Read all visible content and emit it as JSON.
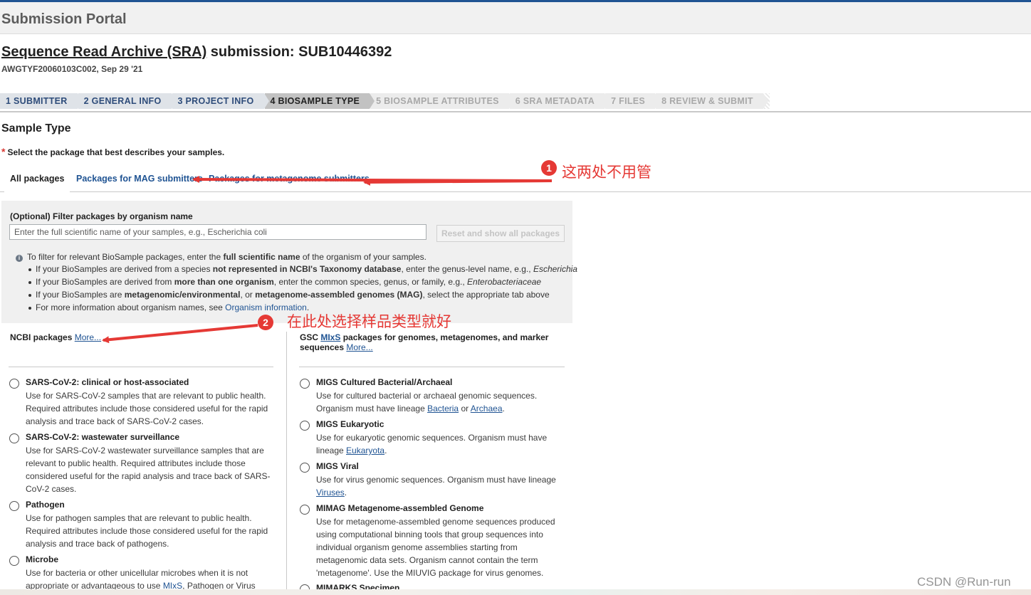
{
  "portal": {
    "title": "Submission Portal"
  },
  "submission": {
    "title_link": "Sequence Read Archive (SRA)",
    "title_rest": " submission: SUB10446392",
    "meta": "AWGTYF20060103C002, Sep 29 '21"
  },
  "steps": [
    {
      "label": "1 SUBMITTER",
      "state": "done"
    },
    {
      "label": "2 GENERAL INFO",
      "state": "done"
    },
    {
      "label": "3 PROJECT INFO",
      "state": "done"
    },
    {
      "label": "4 BIOSAMPLE TYPE",
      "state": "active"
    },
    {
      "label": "5 BIOSAMPLE ATTRIBUTES",
      "state": "disabled"
    },
    {
      "label": "6 SRA METADATA",
      "state": "disabled"
    },
    {
      "label": "7 FILES",
      "state": "disabled"
    },
    {
      "label": "8 REVIEW & SUBMIT",
      "state": "disabled"
    }
  ],
  "section": {
    "title": "Sample Type",
    "required_star": "*",
    "instruction": "Select the package that best describes your samples."
  },
  "tabs": {
    "all": "All packages",
    "mag": "Packages for MAG submitters",
    "metagenome": "Packages for metagenome submitters"
  },
  "filter": {
    "label": "(Optional) Filter packages by organism name",
    "placeholder": "Enter the full scientific name of your samples, e.g., Escherichia coli",
    "reset_button": "Reset and show all packages",
    "info_icon": "info-icon",
    "info_intro_1": "To filter for relevant BioSample packages, enter the ",
    "info_intro_bold": "full scientific name",
    "info_intro_2": " of the organism of your samples.",
    "bullets": {
      "b1_1": "If your BioSamples are derived from a species ",
      "b1_bold": "not represented in NCBI's Taxonomy database",
      "b1_2": ", enter the genus-level name, e.g., ",
      "b1_ital": "Escherichia",
      "b2_1": "If your BioSamples are derived from ",
      "b2_bold": "more than one organism",
      "b2_2": ", enter the common species, genus, or family, e.g., ",
      "b2_ital": "Enterobacteriaceae",
      "b3_1": "If your BioSamples are ",
      "b3_bold1": "metagenomic/environmental",
      "b3_2": ", or ",
      "b3_bold2": "metagenome-assembled genomes (MAG)",
      "b3_3": ", select the appropriate tab above",
      "b4_1": "For more information about organism names, see ",
      "b4_link": "Organism information",
      "b4_2": "."
    }
  },
  "ncbi": {
    "title": "NCBI packages",
    "more": "More...",
    "packages": [
      {
        "title": "SARS-CoV-2: clinical or host-associated",
        "desc": "Use for SARS-CoV-2 samples that are relevant to public health. Required attributes include those considered useful for the rapid analysis and trace back of SARS-CoV-2 cases."
      },
      {
        "title": "SARS-CoV-2: wastewater surveillance",
        "desc": "Use for SARS-CoV-2 wastewater surveillance samples that are relevant to public health. Required attributes include those considered useful for the rapid analysis and trace back of SARS-CoV-2 cases."
      },
      {
        "title": "Pathogen",
        "desc": "Use for pathogen samples that are relevant to public health. Required attributes include those considered useful for the rapid analysis and trace back of pathogens."
      },
      {
        "title": "Microbe",
        "desc_1": "Use for bacteria or other unicellular microbes when it is not appropriate or advantageous to use ",
        "desc_link": "MIxS",
        "desc_2": ", Pathogen or Virus"
      }
    ]
  },
  "gsc": {
    "title_1": "GSC ",
    "title_link": "MIxS",
    "title_2": " packages for genomes, metagenomes, and marker sequences",
    "more": "More...",
    "packages": [
      {
        "title": "MIGS Cultured Bacterial/Archaeal",
        "desc_1": "Use for cultured bacterial or archaeal genomic sequences. Organism must have lineage ",
        "link_1": "Bacteria",
        "desc_2": " or ",
        "link_2": "Archaea",
        "desc_3": "."
      },
      {
        "title": "MIGS Eukaryotic",
        "desc_1": "Use for eukaryotic genomic sequences. Organism must have lineage ",
        "link_1": "Eukaryota",
        "desc_2": "."
      },
      {
        "title": "MIGS Viral",
        "desc_1": "Use for virus genomic sequences. Organism must have lineage ",
        "link_1": "Viruses",
        "desc_2": "."
      },
      {
        "title": "MIMAG Metagenome-assembled Genome",
        "desc": "Use for metagenome-assembled genome sequences produced using computational binning tools that group sequences into individual organism genome assemblies starting from metagenomic data sets. Organism cannot contain the term 'metagenome'. Use the MIUVIG package for virus genomes."
      },
      {
        "title": "MIMARKS Specimen"
      }
    ]
  },
  "annotations": {
    "badge_1": "1",
    "text_1": "这两处不用管",
    "badge_2": "2",
    "text_2": "在此处选择样品类型就好",
    "color": "#e53935"
  },
  "watermark": "CSDN @Run-run"
}
